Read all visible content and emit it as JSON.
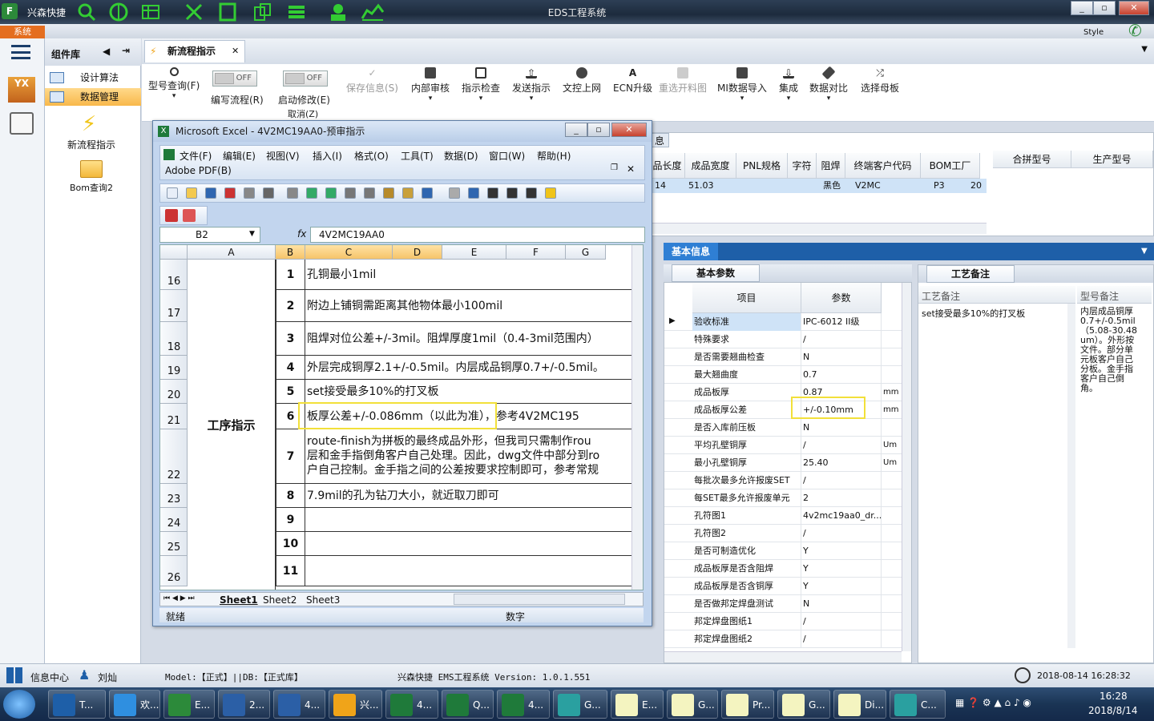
{
  "titlebar": {
    "app_name": "兴森快捷",
    "title": "EDS工程系统",
    "style_label": "Style"
  },
  "sysmenu": {
    "label": "系统"
  },
  "panel": {
    "title": "组件库",
    "items": [
      {
        "label": "设计算法"
      },
      {
        "label": "数据管理"
      }
    ],
    "shortcuts": [
      {
        "label": "新流程指示"
      },
      {
        "label": "Bom查询2"
      }
    ],
    "rail_icon": "YX"
  },
  "tab": {
    "label": "新流程指示"
  },
  "toolbar": {
    "query": "型号查询(F)",
    "edit_flow": "编写流程(R)",
    "start_modify": "启动修改(E)",
    "cancel": "取消(Z)",
    "off": "OFF",
    "save": "保存信息(S)",
    "internal_review": "内部审核",
    "check": "指示检查",
    "send": "发送指示",
    "upload": "文控上网",
    "ecn": "ECN升级",
    "reselect": "重选开料图",
    "mi_import": "MI数据导入",
    "integrate": "集成",
    "compare": "数据对比",
    "select_mother": "选择母板"
  },
  "bggrid": {
    "tab_label": "息",
    "headers": [
      "品长度",
      "成品宽度",
      "PNL规格",
      "字符",
      "阻焊",
      "终端客户代码",
      "BOM工厂",
      "合拼型号",
      "生产型号"
    ],
    "row": [
      "14",
      "51.03",
      "",
      "",
      "黑色",
      "V2MC",
      "P3",
      "20"
    ]
  },
  "excel": {
    "title": "Microsoft Excel - 4V2MC19AA0-预审指示",
    "menus": [
      "文件(F)",
      "编辑(E)",
      "视图(V)",
      "插入(I)",
      "格式(O)",
      "工具(T)",
      "数据(D)",
      "窗口(W)",
      "帮助(H)"
    ],
    "menu2": "Adobe PDF(B)",
    "namebox": "B2",
    "fx": "fx",
    "formula": "4V2MC19AA0",
    "columns": [
      "A",
      "B",
      "C",
      "D",
      "E",
      "F",
      "G"
    ],
    "section_label": "工序指示",
    "rows": [
      {
        "rowhead": "16",
        "num": "1",
        "text": "孔铜最小1mil"
      },
      {
        "rowhead": "17",
        "num": "2",
        "text": "附边上铺铜需距离其他物体最小100mil"
      },
      {
        "rowhead": "18",
        "num": "3",
        "text": "阻焊对位公差+/-3mil。阻焊厚度1mil（0.4-3mil范围内）"
      },
      {
        "rowhead": "19",
        "num": "4",
        "text": "外层完成铜厚2.1+/-0.5mil。内层成品铜厚0.7+/-0.5mil。"
      },
      {
        "rowhead": "20",
        "num": "5",
        "text": "set接受最多10%的打叉板"
      },
      {
        "rowhead": "21",
        "num": "6",
        "text": "板厚公差+/-0.086mm（以此为准），参考4V2MC195"
      },
      {
        "rowhead": "22",
        "num": "7",
        "text": "route-finish为拼板的最终成品外形，但我司只需制作rou|层和金手指倒角客户自己处理。因此，dwg文件中部分到ro|户自己控制。金手指之间的公差按要求控制即可，参考常规"
      },
      {
        "rowhead": "23",
        "num": "8",
        "text": "7.9mil的孔为钻刀大小，就近取刀即可"
      },
      {
        "rowhead": "24",
        "num": "9",
        "text": ""
      },
      {
        "rowhead": "25",
        "num": "10",
        "text": ""
      },
      {
        "rowhead": "26",
        "num": "11",
        "text": ""
      }
    ],
    "sheets": [
      "Sheet1",
      "Sheet2",
      "Sheet3"
    ],
    "status_ready": "就绪",
    "status_mode": "数字"
  },
  "basic": {
    "tab": "基本信息",
    "params_tab": "基本参数",
    "col_item": "项目",
    "col_param": "参数",
    "rows": [
      {
        "k": "验收标准",
        "v": "IPC-6012 II级",
        "u": ""
      },
      {
        "k": "特殊要求",
        "v": "/",
        "u": ""
      },
      {
        "k": "是否需要翘曲检查",
        "v": "N",
        "u": ""
      },
      {
        "k": "最大翘曲度",
        "v": "0.7",
        "u": ""
      },
      {
        "k": "成品板厚",
        "v": "0.87",
        "u": "mm"
      },
      {
        "k": "成品板厚公差",
        "v": "+/-0.10mm",
        "u": "mm"
      },
      {
        "k": "是否入库前压板",
        "v": "N",
        "u": ""
      },
      {
        "k": "平均孔壁铜厚",
        "v": "/",
        "u": "Um"
      },
      {
        "k": "最小孔壁铜厚",
        "v": "25.40",
        "u": "Um"
      },
      {
        "k": "每批次最多允许报废SET",
        "v": "/",
        "u": ""
      },
      {
        "k": "每SET最多允许报废单元",
        "v": "2",
        "u": ""
      },
      {
        "k": "孔符图1",
        "v": "4v2mc19aa0_dr...",
        "u": ""
      },
      {
        "k": "孔符图2",
        "v": "/",
        "u": ""
      },
      {
        "k": "是否可制造优化",
        "v": "Y",
        "u": ""
      },
      {
        "k": "成品板厚是否含阻焊",
        "v": "Y",
        "u": ""
      },
      {
        "k": "成品板厚是否含铜厚",
        "v": "Y",
        "u": ""
      },
      {
        "k": "是否做邦定焊盘测试",
        "v": "N",
        "u": ""
      },
      {
        "k": "邦定焊盘图纸1",
        "v": "/",
        "u": ""
      },
      {
        "k": "邦定焊盘图纸2",
        "v": "/",
        "u": ""
      }
    ]
  },
  "craft": {
    "tab": "工艺备注",
    "col1": "工艺备注",
    "col2": "型号备注",
    "note1": "set接受最多10%的打叉板",
    "note2": "内层成品铜厚0.7+/-0.5mil（5.08-30.48um）。外形按文件。部分单元板客户自己分板。金手指客户自己倒角。"
  },
  "appstatus": {
    "info_center": "信息中心",
    "user": "刘灿",
    "model_db": "Model:【正式】||DB:【正式库】",
    "version": "兴森快捷 EMS工程系统 Version: 1.0.1.551",
    "datetime": "2018-08-14 16:28:32"
  },
  "taskbar": {
    "items": [
      {
        "label": "T...",
        "icon": "save-disk"
      },
      {
        "label": "欢...",
        "icon": "ie"
      },
      {
        "label": "E...",
        "icon": "eds-f"
      },
      {
        "label": "2...",
        "icon": "word"
      },
      {
        "label": "4...",
        "icon": "word"
      },
      {
        "label": "兴...",
        "icon": "shell"
      },
      {
        "label": "4...",
        "icon": "excel"
      },
      {
        "label": "Q...",
        "icon": "excel"
      },
      {
        "label": "4...",
        "icon": "excel"
      },
      {
        "label": "G...",
        "icon": "tool"
      },
      {
        "label": "E...",
        "icon": "excel-x"
      },
      {
        "label": "G...",
        "icon": "excel-x"
      },
      {
        "label": "Pr...",
        "icon": "excel-x"
      },
      {
        "label": "G...",
        "icon": "excel-x"
      },
      {
        "label": "Di...",
        "icon": "excel-x"
      },
      {
        "label": "C...",
        "icon": "tool"
      }
    ],
    "time": "16:28",
    "date": "2018/8/14"
  },
  "colors": {
    "accent": "#2f7fd4",
    "highlight": "#f2e03a",
    "selected_nav": "#f8b84b"
  }
}
